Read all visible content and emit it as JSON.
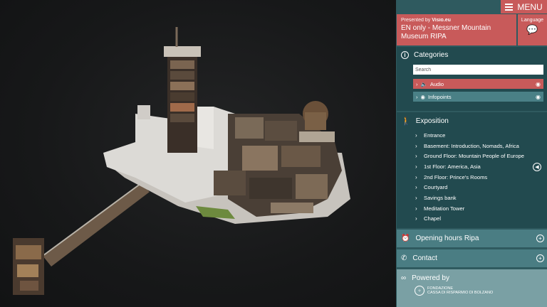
{
  "menu": {
    "label": "MENU"
  },
  "header": {
    "presented_by": "Presented by",
    "presenter": "Visio.eu",
    "title": "EN only - Messner Mountain Museum RIPA"
  },
  "language": {
    "label": "Language"
  },
  "categories": {
    "title": "Categories",
    "search_placeholder": "Search",
    "items": [
      {
        "label": "Audio",
        "color": "#c85a5a"
      },
      {
        "label": "Infopoints",
        "color": "#4a8086"
      }
    ]
  },
  "exposition": {
    "title": "Exposition",
    "items": [
      {
        "label": "Entrance"
      },
      {
        "label": "Basement: Introduction, Nomads, Africa"
      },
      {
        "label": "Ground Floor: Mountain People of Europe"
      },
      {
        "label": "1st Floor: America, Asia"
      },
      {
        "label": "2nd Floor: Prince's Rooms"
      },
      {
        "label": "Courtyard"
      },
      {
        "label": "Savings bank"
      },
      {
        "label": "Meditation Tower"
      },
      {
        "label": "Chapel"
      }
    ]
  },
  "opening_hours": {
    "title": "Opening hours Ripa"
  },
  "contact": {
    "title": "Contact"
  },
  "powered": {
    "title": "Powered by",
    "sponsor_line1": "FONDAZIONE",
    "sponsor_line2": "CASSA DI RISPARMIO DI BOLZANO"
  },
  "colors": {
    "accent": "#c85a5a",
    "panel": "#224a4f",
    "bar": "#4a7d83",
    "powered": "#7aa0a4"
  }
}
